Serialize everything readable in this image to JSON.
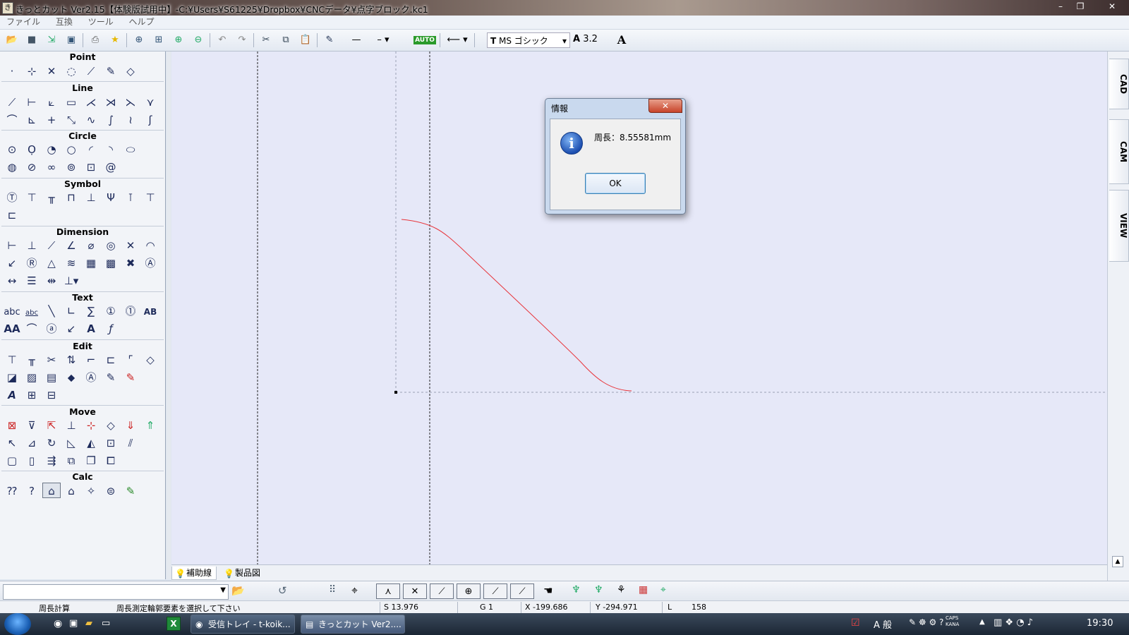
{
  "window": {
    "title": "きっとカット Ver2.15【体験版試用中】-C:¥Users¥S61225¥Dropbox¥CNCデータ¥点字ブロック.kc1",
    "app_icon_glyph": "き",
    "min_glyph": "–",
    "max_glyph": "❐",
    "close_glyph": "✕"
  },
  "menu": [
    "ファイル",
    "互換",
    "ツール",
    "ヘルプ"
  ],
  "toolbar": {
    "font_name": "MS ゴシック",
    "font_size": "3.2",
    "line_style_glyph": "—",
    "auto_label": "AUTO"
  },
  "palette": {
    "sections": {
      "point": "Point",
      "line": "Line",
      "circle": "Circle",
      "symbol": "Symbol",
      "dimension": "Dimension",
      "text": "Text",
      "edit": "Edit",
      "move": "Move",
      "calc": "Calc"
    },
    "text_tools": [
      "abc",
      "abc",
      "AA",
      "A",
      "AB"
    ]
  },
  "right_tabs": [
    "CAD",
    "CAM",
    "VIEW"
  ],
  "sheet_tabs": [
    "補助線",
    "製品図"
  ],
  "dialog": {
    "title": "情報",
    "close_glyph": "✕",
    "icon_glyph": "i",
    "message": "周長：8.55581mm",
    "ok_label": "OK"
  },
  "status": {
    "mode": "周長計算",
    "prompt": "周長測定輪郭要素を選択して下さい",
    "s": "S  13.976",
    "g": "G 1",
    "x": "X  -199.686",
    "y": "Y  -294.971",
    "l_label": "L",
    "l_value": "158"
  },
  "taskbar": {
    "tasks": [
      "受信トレイ - t-koik...",
      "きっとカット Ver2...."
    ],
    "excel_label": "X",
    "clock": "19:30",
    "tray_text": "A 般",
    "caps": "CAPS",
    "kana": "KANA"
  }
}
